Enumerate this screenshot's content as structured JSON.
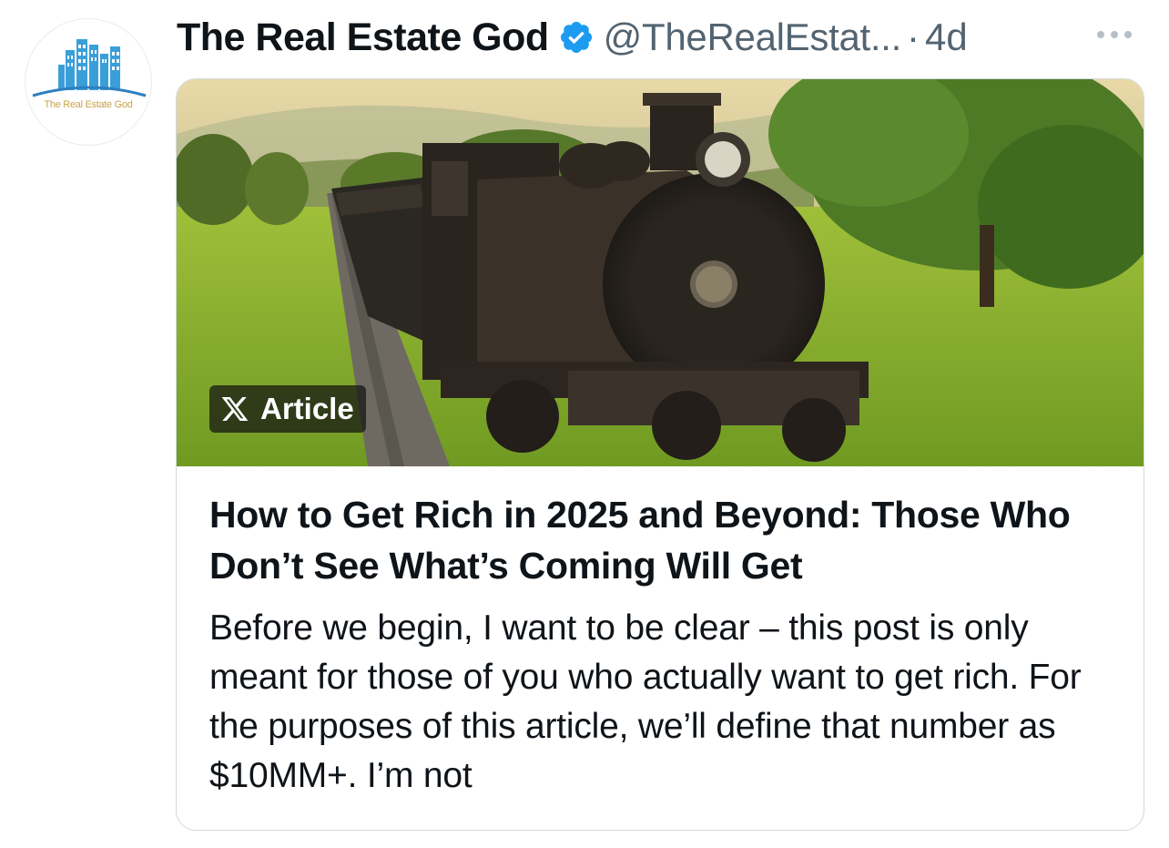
{
  "author": {
    "display_name": "The Real Estate God",
    "handle": "@TheRealEstat...",
    "separator": "·",
    "time_ago": "4d",
    "avatar_text": "The Real Estate God",
    "verified": true
  },
  "card": {
    "badge_label": "Article",
    "title": "How to Get Rich in 2025 and Beyond: Those Who Don’t See What’s Coming Will Get",
    "excerpt": "Before we begin, I want to be clear – this post is only meant for those of you who actually want to get rich. For the purposes of this article, we’ll define that number as $10MM+. I’m not"
  },
  "icons": {
    "verified": "verified-badge-icon",
    "more": "more-options-icon",
    "x_logo": "x-logo-icon"
  },
  "colors": {
    "verified_blue": "#1d9bf0",
    "secondary_text": "#536471",
    "primary_text": "#0f1419",
    "card_border": "#cfd9de"
  }
}
